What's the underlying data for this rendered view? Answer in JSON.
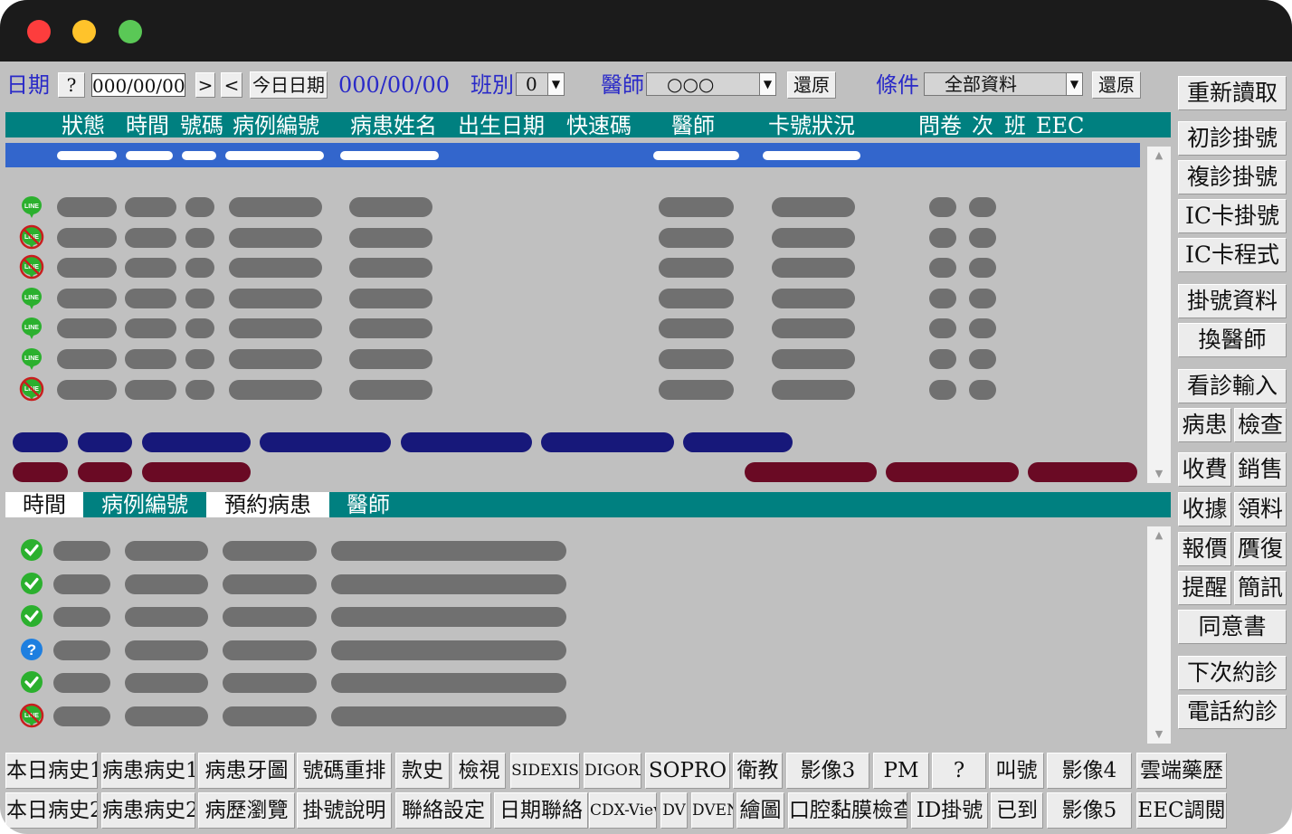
{
  "window": {
    "controls": [
      "close",
      "minimize",
      "zoom"
    ]
  },
  "toolbar": {
    "date_label": "日期",
    "help_button": "?",
    "date_value": "000/00/00",
    "next_button": ">",
    "prev_button": "<",
    "today_button": "今日日期",
    "date_display": "000/00/00",
    "shift_label": "班別",
    "shift_value": "0",
    "doctor_label": "醫師",
    "doctor_value": "○○○",
    "restore1": "還原",
    "condition_label": "條件",
    "condition_value": "全部資料",
    "restore2": "還原",
    "reload_button": "重新讀取"
  },
  "upper_table": {
    "headers": [
      "狀態",
      "時間",
      "號碼",
      "病例編號",
      "病患姓名",
      "出生日期",
      "快速碼",
      "醫師",
      "卡號狀況",
      "問卷",
      "次",
      "班",
      "EEC"
    ],
    "row_icons": [
      "line-icon",
      "line-blocked-icon",
      "line-blocked-icon",
      "line-icon",
      "line-icon",
      "line-icon",
      "line-blocked-icon"
    ]
  },
  "lower_table": {
    "tabs": [
      "時間",
      "病例編號",
      "預約病患",
      "醫師"
    ],
    "row_icons": [
      "check-icon",
      "check-icon",
      "check-icon",
      "question-icon",
      "check-icon",
      "line-blocked-icon"
    ]
  },
  "sidebar": {
    "single": {
      "first_visit": "初診掛號",
      "return_visit": "複診掛號",
      "ic_register": "IC卡掛號",
      "ic_program": "IC卡程式",
      "register_data": "掛號資料",
      "change_doctor": "換醫師",
      "consult_input": "看診輸入",
      "consent": "同意書",
      "next_appt": "下次約診",
      "phone_appt": "電話約診"
    },
    "pairs": [
      [
        "病患",
        "檢查"
      ],
      [
        "收費",
        "銷售"
      ],
      [
        "收據",
        "領料"
      ],
      [
        "報價",
        "贋復"
      ],
      [
        "提醒",
        "簡訊"
      ]
    ]
  },
  "bottom_row1": [
    "本日病史1",
    "病患病史1",
    "病患牙圖",
    "號碼重排",
    "款史",
    "檢視",
    "SIDEXIS",
    "DIGORA",
    "SOPRO",
    "衛教",
    "影像3",
    "PM",
    "?",
    "叫號",
    "影像4",
    "雲端藥歷"
  ],
  "bottom_row2": [
    "本日病史2",
    "病患病史2",
    "病歷瀏覽",
    "掛號說明",
    "聯絡設定",
    "日期聯絡",
    "CDX-View",
    "DV",
    "DVEND",
    "繪圖",
    "口腔黏膜檢查",
    "ID掛號",
    "已到",
    "影像5",
    "EEC調閱"
  ],
  "colors": {
    "teal": "#008080",
    "selection_blue": "#3366cc",
    "navy": "#17187a",
    "maroon": "#6a0a24",
    "label_blue": "#2a2ac8"
  }
}
